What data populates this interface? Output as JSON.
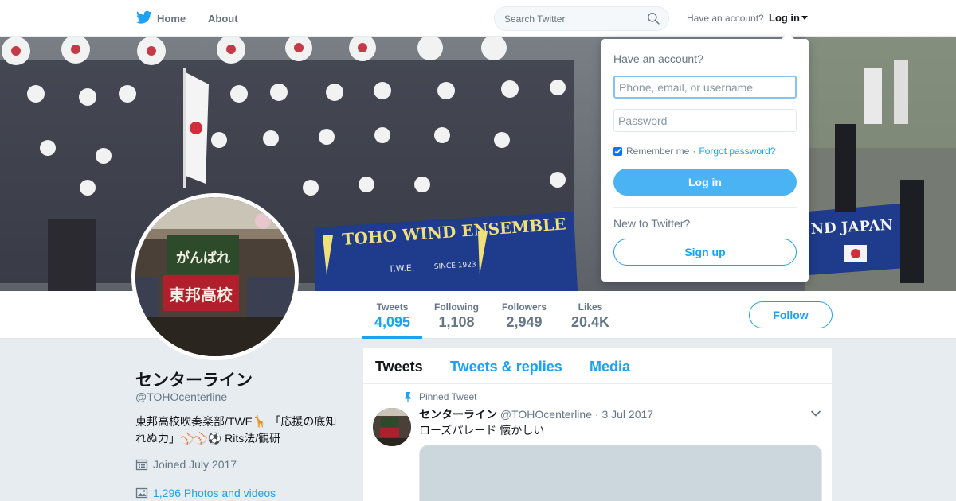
{
  "nav": {
    "home": "Home",
    "about": "About",
    "search_placeholder": "Search Twitter",
    "have_account": "Have an account?",
    "login": "Log in"
  },
  "banner": {
    "banner_text_left": "TOHO WIND ENSEMBLE",
    "banner_text_sub": "T.W.E.",
    "banner_text_since": "SINCE 1923",
    "banner_text_right": "ND JAPAN"
  },
  "avatar": {
    "sign_top": "がんばれ",
    "sign_bottom": "東邦高校"
  },
  "stats": [
    {
      "label": "Tweets",
      "value": "4,095"
    },
    {
      "label": "Following",
      "value": "1,108"
    },
    {
      "label": "Followers",
      "value": "2,949"
    },
    {
      "label": "Likes",
      "value": "20.4K"
    }
  ],
  "follow_button": "Follow",
  "profile": {
    "name": "センターライン",
    "handle": "@TOHOcenterline",
    "bio": "東邦高校吹奏楽部/TWE🦒 「応援の底知れぬ力」⚾⚾⚽ Rits法/観研",
    "joined": "Joined July 2017",
    "photos": "1,296 Photos and videos"
  },
  "timeline": {
    "tabs": [
      "Tweets",
      "Tweets & replies",
      "Media"
    ],
    "pinned_label": "Pinned Tweet",
    "tweet": {
      "name": "センターライン",
      "handle": "@TOHOcenterline",
      "separator": "·",
      "date": "3 Jul 2017",
      "text": "ローズパレード 懐かしい"
    }
  },
  "login_dropdown": {
    "title": "Have an account?",
    "username_placeholder": "Phone, email, or username",
    "password_placeholder": "Password",
    "remember": "Remember me",
    "separator": "·",
    "forgot": "Forgot password?",
    "login_button": "Log in",
    "new_to_twitter": "New to Twitter?",
    "signup_button": "Sign up"
  },
  "colors": {
    "brand": "#1da1f2",
    "background": "#e6ecf0",
    "muted": "#657786"
  },
  "icons": [
    "twitter-bird-icon",
    "search-icon",
    "calendar-icon",
    "photo-icon",
    "pin-icon",
    "chevron-down-icon"
  ]
}
